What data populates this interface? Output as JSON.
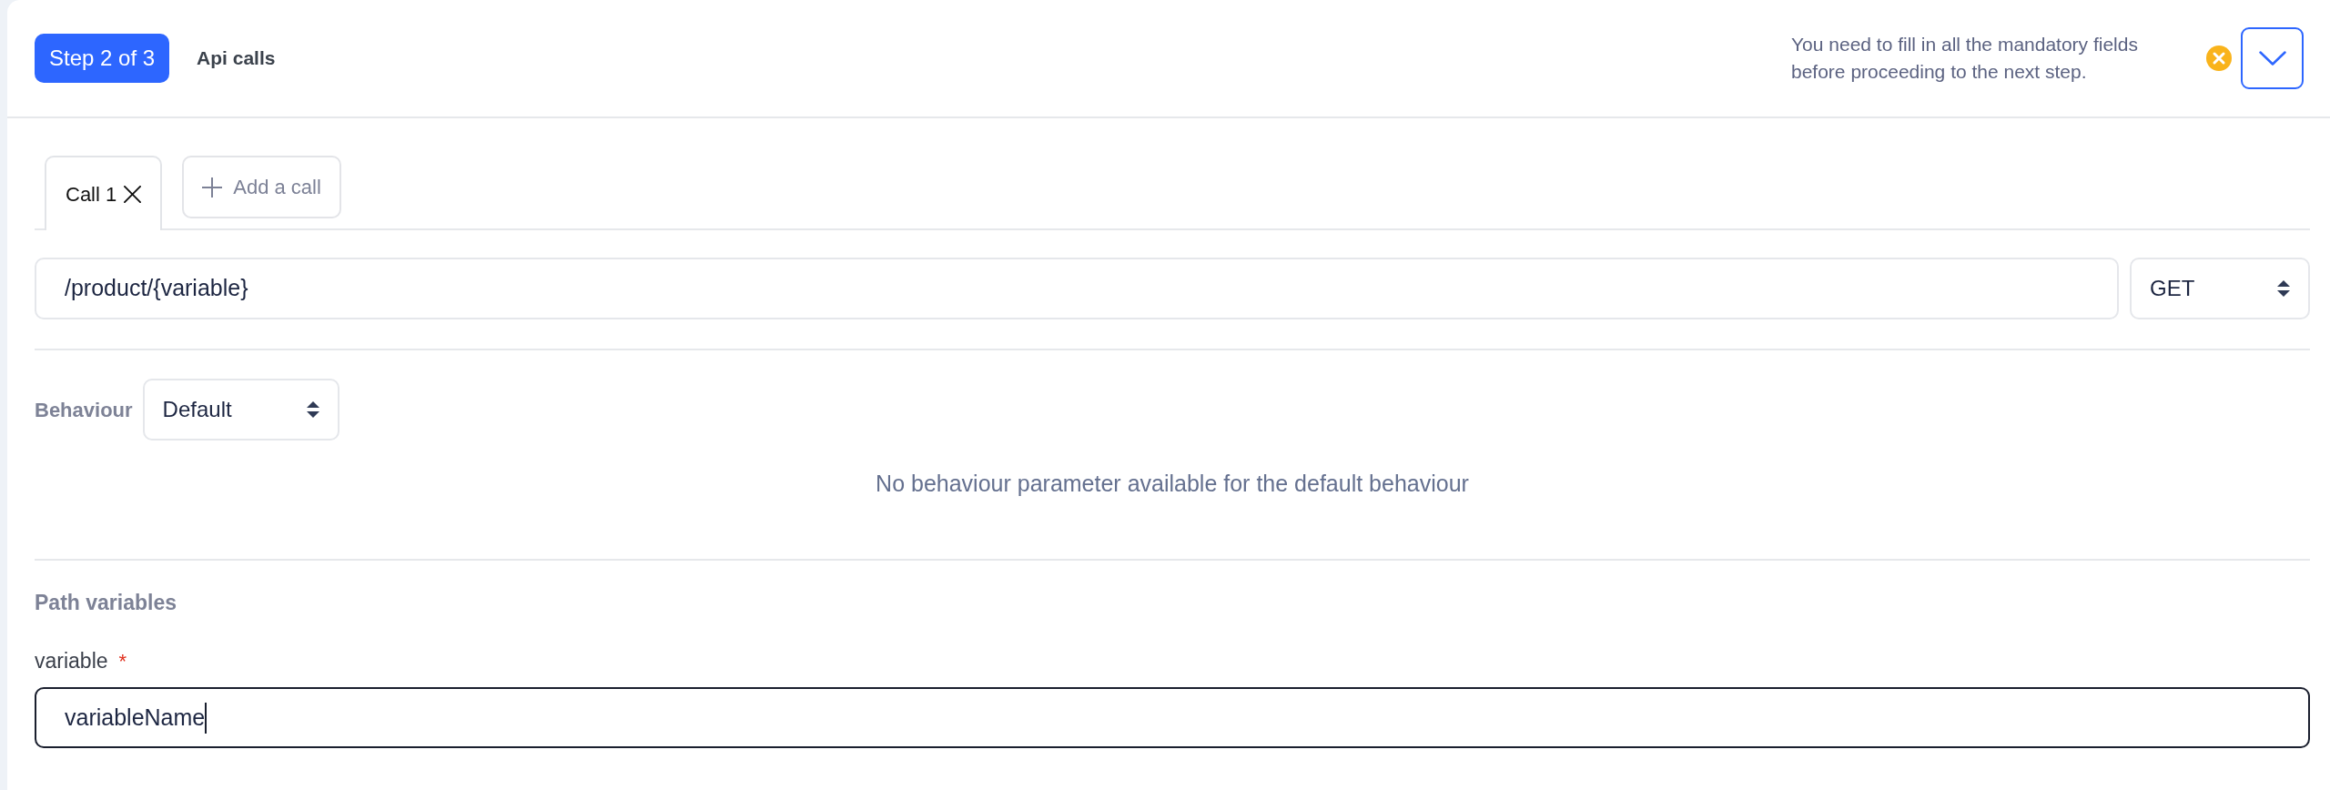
{
  "header": {
    "step_badge": "Step 2 of 3",
    "title": "Api calls",
    "warning": "You need to fill in all the mandatory fields before proceeding to the next step."
  },
  "call_tabs": [
    {
      "label": "Call 1",
      "selected": true
    }
  ],
  "add_call_button": "Add a call",
  "request": {
    "url": "/product/{variable}",
    "method": "GET"
  },
  "behaviour": {
    "label": "Behaviour",
    "value": "Default",
    "message": "No behaviour parameter available for the default behaviour"
  },
  "path_variables": {
    "title": "Path variables",
    "fields": [
      {
        "label": "variable",
        "required_mark": "*",
        "value": "variableName",
        "focused": true
      }
    ]
  }
}
